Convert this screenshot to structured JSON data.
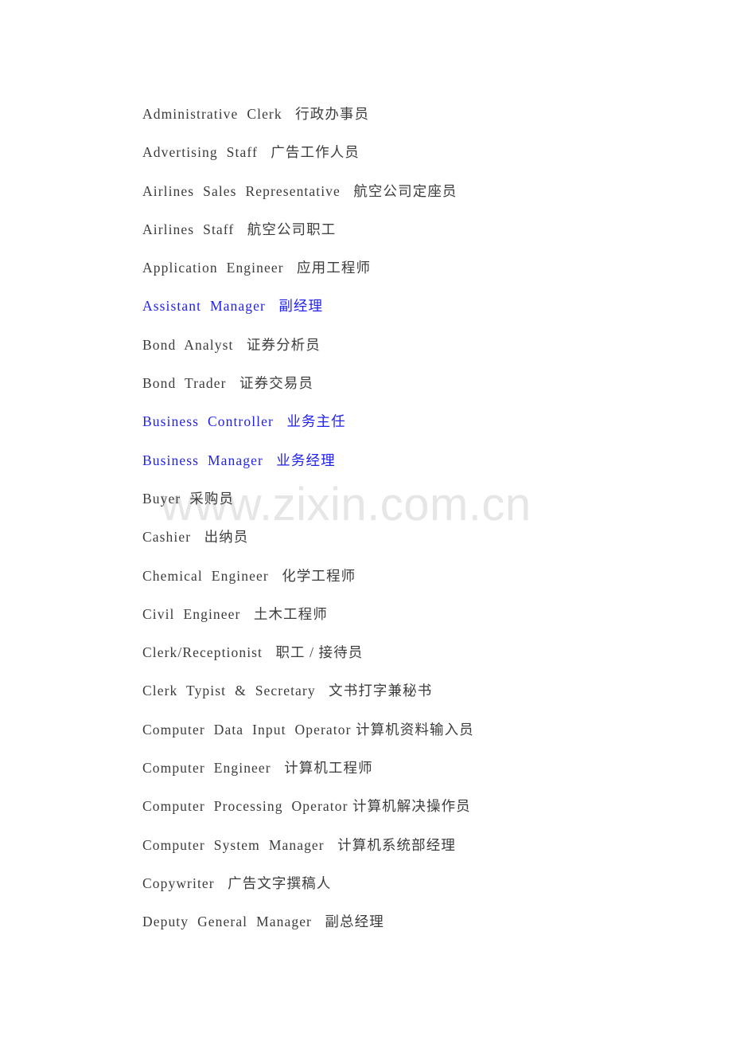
{
  "document": {
    "type": "word-list",
    "background_color": "#ffffff",
    "text_color": "#3c3c3c",
    "link_color": "#2222ee",
    "watermark": {
      "text": "www.zixin.com.cn",
      "color": "#e6e6e6"
    },
    "lines": [
      {
        "text": "Administrative  Clerk   行政办事员",
        "link": false
      },
      {
        "text": "Advertising  Staff   广告工作人员",
        "link": false
      },
      {
        "text": "Airlines  Sales  Representative   航空公司定座员",
        "link": false
      },
      {
        "text": "Airlines  Staff   航空公司职工",
        "link": false
      },
      {
        "text": "Application  Engineer   应用工程师",
        "link": false
      },
      {
        "text": "Assistant  Manager   副经理",
        "link": true
      },
      {
        "text": "Bond  Analyst   证券分析员",
        "link": false
      },
      {
        "text": "Bond  Trader   证券交易员",
        "link": false
      },
      {
        "text": "Business  Controller   业务主任",
        "link": true
      },
      {
        "text": "Business  Manager   业务经理",
        "link": true
      },
      {
        "text": "Buyer  采购员",
        "link": false
      },
      {
        "text": "Cashier   出纳员",
        "link": false
      },
      {
        "text": "Chemical  Engineer   化学工程师",
        "link": false
      },
      {
        "text": "Civil  Engineer   土木工程师",
        "link": false
      },
      {
        "text": "Clerk/Receptionist   职工 / 接待员",
        "link": false
      },
      {
        "text": "Clerk  Typist  &  Secretary   文书打字兼秘书",
        "link": false
      },
      {
        "text": "Computer  Data  Input  Operator 计算机资料输入员",
        "link": false
      },
      {
        "text": "Computer  Engineer   计算机工程师",
        "link": false
      },
      {
        "text": "Computer  Processing  Operator 计算机解决操作员",
        "link": false
      },
      {
        "text": "Computer  System  Manager   计算机系统部经理",
        "link": false
      },
      {
        "text": "Copywriter   广告文字撰稿人",
        "link": false
      },
      {
        "text": "Deputy  General  Manager   副总经理",
        "link": false
      }
    ]
  }
}
